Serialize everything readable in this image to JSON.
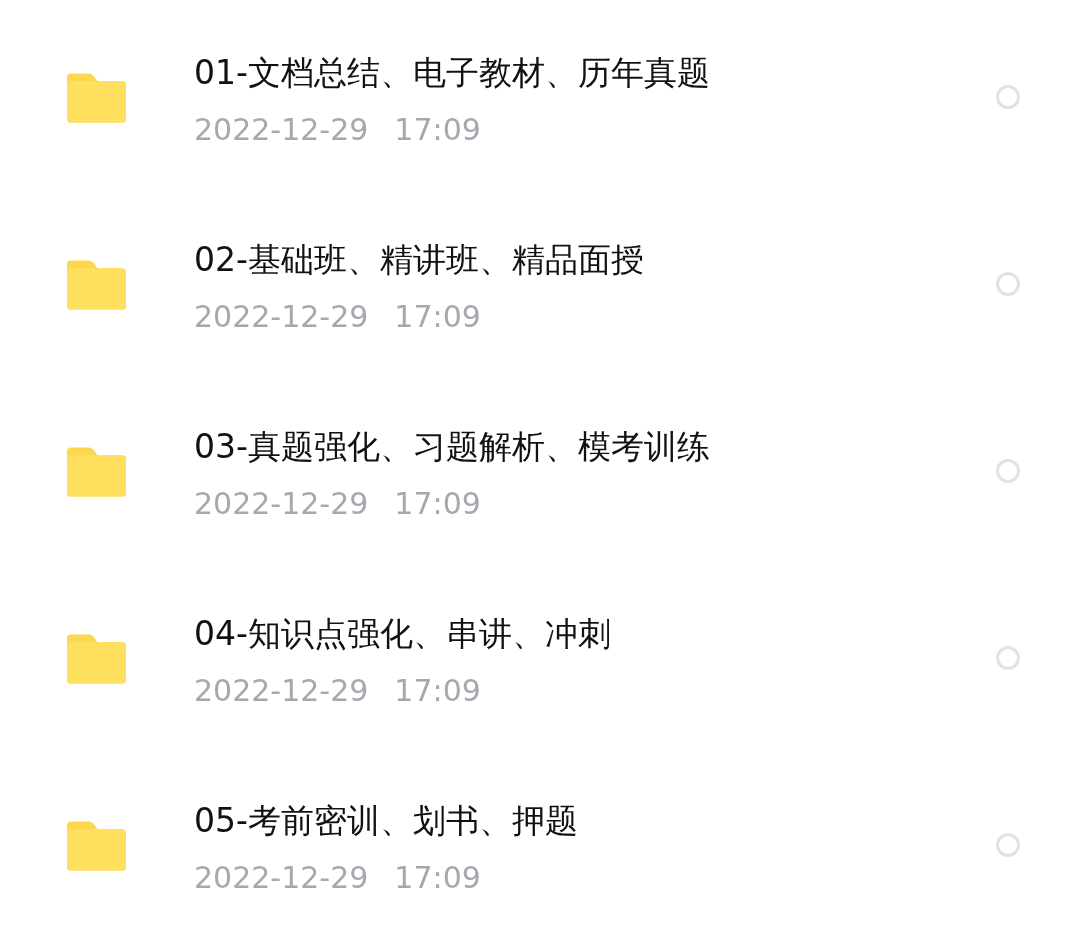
{
  "files": [
    {
      "name": "01-文档总结、电子教材、历年真题",
      "date": "2022-12-29",
      "time": "17:09",
      "selected": false
    },
    {
      "name": "02-基础班、精讲班、精品面授",
      "date": "2022-12-29",
      "time": "17:09",
      "selected": false
    },
    {
      "name": "03-真题强化、习题解析、模考训练",
      "date": "2022-12-29",
      "time": "17:09",
      "selected": false
    },
    {
      "name": "04-知识点强化、串讲、冲刺",
      "date": "2022-12-29",
      "time": "17:09",
      "selected": false
    },
    {
      "name": "05-考前密训、划书、押题",
      "date": "2022-12-29",
      "time": "17:09",
      "selected": false
    }
  ]
}
